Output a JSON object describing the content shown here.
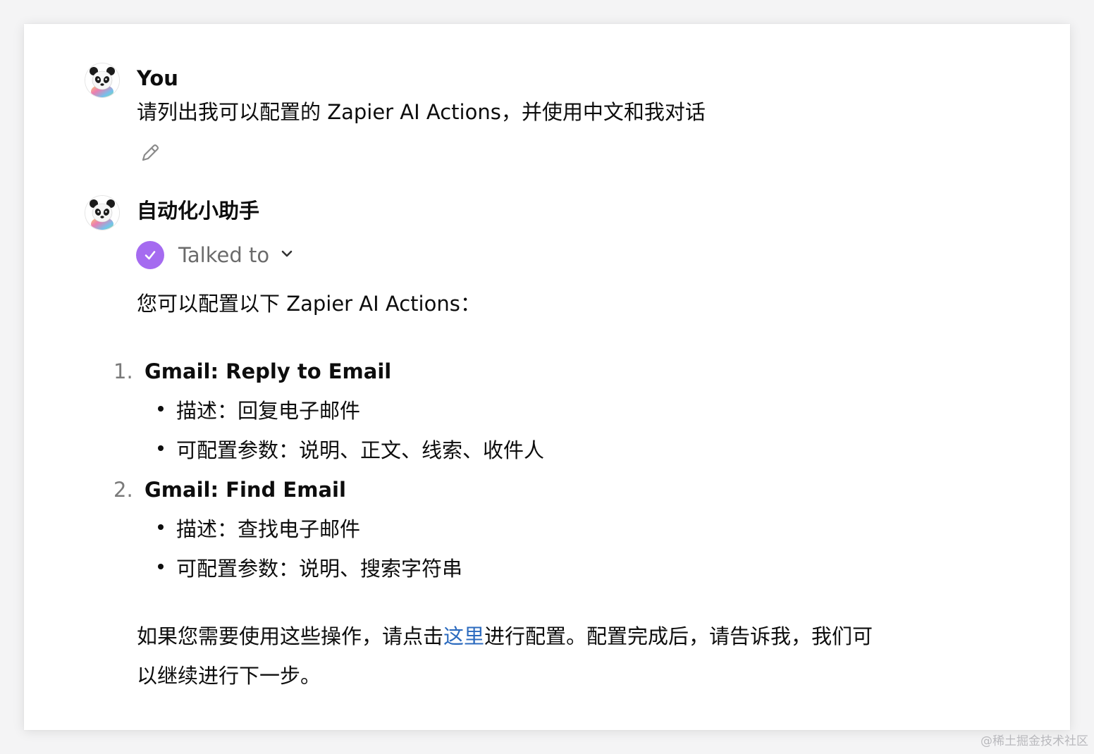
{
  "user_message": {
    "author": "You",
    "text": "请列出我可以配置的 Zapier AI Actions，并使用中文和我对话",
    "edit_icon": "pencil-icon"
  },
  "assistant_message": {
    "author": "自动化小助手",
    "tool_status": {
      "icon": "check-icon",
      "label": "Talked to",
      "chevron_icon": "chevron-down-icon"
    },
    "intro": "您可以配置以下 Zapier AI Actions：",
    "actions": [
      {
        "number": "1.",
        "title": "Gmail: Reply to Email",
        "bullets": [
          "描述：回复电子邮件",
          "可配置参数：说明、正文、线索、收件人"
        ]
      },
      {
        "number": "2.",
        "title": "Gmail: Find Email",
        "bullets": [
          "描述：查找电子邮件",
          "可配置参数：说明、搜索字符串"
        ]
      }
    ],
    "closing": {
      "before_link": "如果您需要使用这些操作，请点击",
      "link_text": "这里",
      "after_link": "进行配置。配置完成后，请告诉我，我们可",
      "line2": "以继续进行下一步。"
    }
  },
  "watermark": "@稀土掘金技术社区",
  "colors": {
    "check_circle": "#a56bf0",
    "link": "#2c6bbf",
    "muted_text": "#6b6b6b"
  }
}
